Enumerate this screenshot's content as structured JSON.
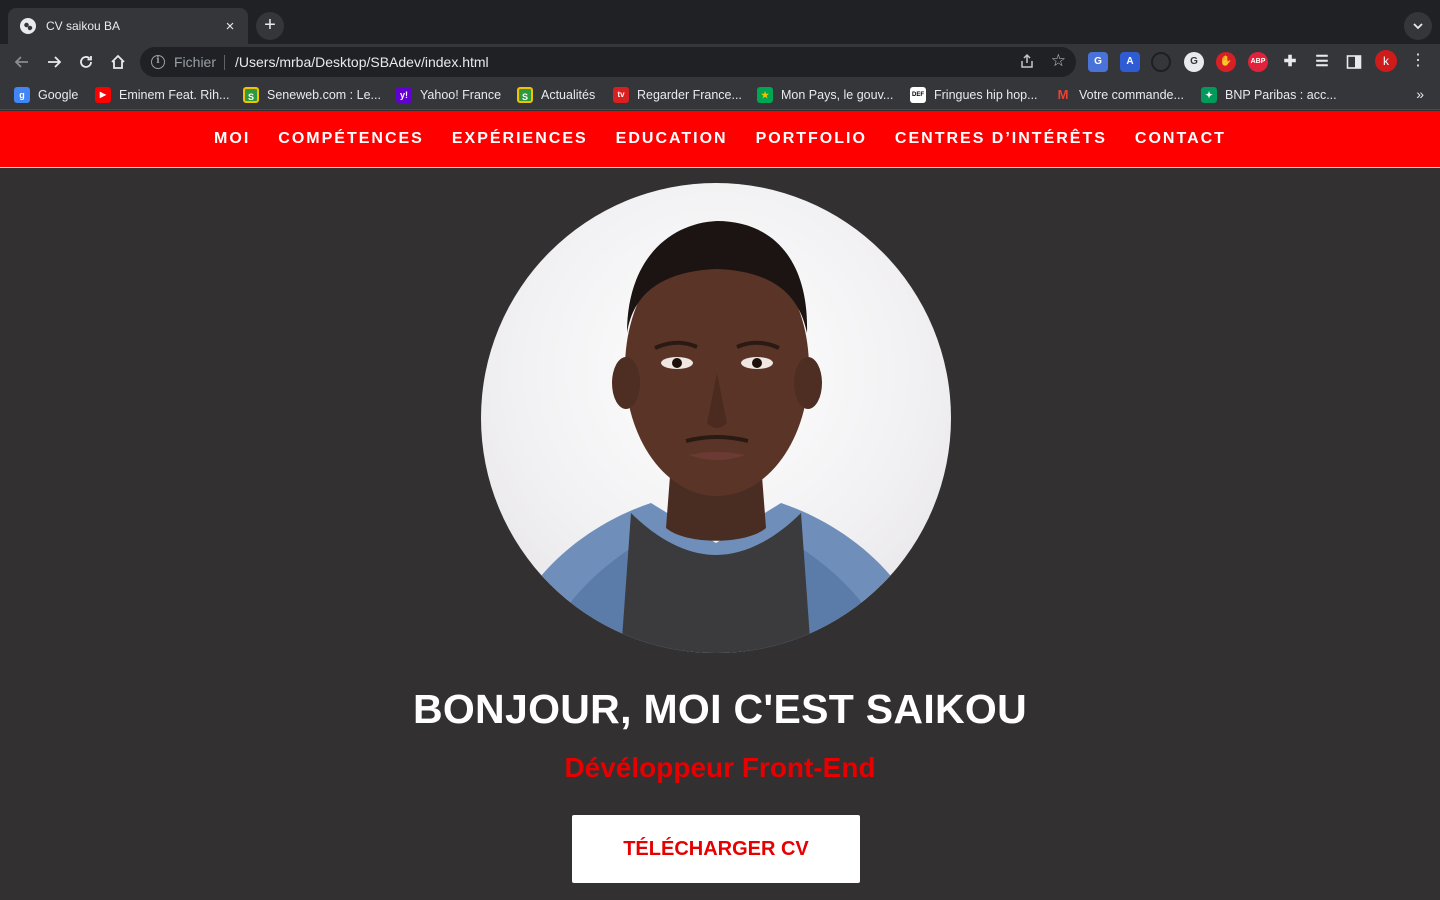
{
  "browser": {
    "tab_title": "CV saikou BA",
    "tab_close": "×",
    "new_tab": "+",
    "tab_search": "⌄",
    "address": {
      "scheme": "Fichier",
      "url": "/Users/mrba/Desktop/SBAdev/index.html"
    },
    "profile_initial": "k",
    "bookmarks": [
      {
        "label": "Google",
        "icon": "google-icon",
        "color": "#4285f4",
        "glyph": "g"
      },
      {
        "label": "Eminem Feat. Rih...",
        "icon": "youtube-icon",
        "color": "#ff0000",
        "glyph": "▶"
      },
      {
        "label": "Seneweb.com : Le...",
        "icon": "seneweb-icon",
        "color": "#2e9b3a",
        "glyph": "S"
      },
      {
        "label": "Yahoo! France",
        "icon": "yahoo-icon",
        "color": "#6001d2",
        "glyph": "y!"
      },
      {
        "label": "Actualités",
        "icon": "news-icon",
        "color": "#2e9b3a",
        "glyph": "S"
      },
      {
        "label": "Regarder France...",
        "icon": "tv-icon",
        "color": "#d92020",
        "glyph": "tv"
      },
      {
        "label": "Mon Pays, le gouv...",
        "icon": "flag-icon",
        "color": "#00a651",
        "glyph": "★"
      },
      {
        "label": "Fringues hip hop...",
        "icon": "def-icon",
        "color": "#ffffff",
        "glyph": "DEF"
      },
      {
        "label": "Votre commande...",
        "icon": "gmail-icon",
        "color": "#ea4335",
        "glyph": "M"
      },
      {
        "label": "BNP Paribas : acc...",
        "icon": "bnp-icon",
        "color": "#009a5a",
        "glyph": "✦"
      }
    ],
    "bookmarks_more": "»"
  },
  "site": {
    "nav": [
      "MOI",
      "COMPÉTENCES",
      "EXPÉRIENCES",
      "EDUCATION",
      "PORTFOLIO",
      "CENTRES D’INTÉRÊTS",
      "CONTACT"
    ],
    "hero": {
      "headline": "BONJOUR, MOI C'EST SAIKOU",
      "role": "Dévéloppeur Front-End",
      "cta": "TÉLÉCHARGER CV"
    }
  },
  "colors": {
    "nav_bg": "#ff0000",
    "page_bg": "#323030",
    "accent_text": "#e60000",
    "button_bg": "#ffffff"
  }
}
